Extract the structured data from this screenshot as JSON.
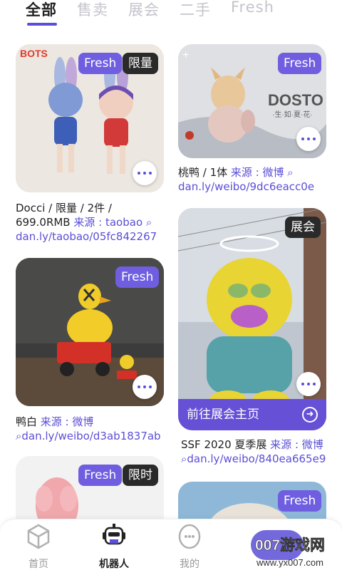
{
  "tabs": [
    "全部",
    "售卖",
    "展会",
    "二手",
    "Fresh"
  ],
  "cards": {
    "docci": {
      "badges": [
        "Fresh",
        "限量"
      ],
      "text": "Docci / 限量 /  2件 / 699.0RMB",
      "source": "来源 : taobao",
      "link": "dan.ly/taobao/05fc842267",
      "logo": "BOTS"
    },
    "taoya": {
      "badges": [
        "Fresh"
      ],
      "text": "桃鸭 / 1体",
      "source": "来源 : 微博",
      "link": "dan.ly/weibo/9dc6eacc0e",
      "image_text": "DOSTO",
      "image_subtext": "·生·如·夏·花·"
    },
    "yabai": {
      "badges": [
        "Fresh"
      ],
      "text": "鸭白",
      "source": "来源 : 微博",
      "link": "dan.ly/weibo/d3ab1837ab"
    },
    "ssf": {
      "badges": [
        "展会"
      ],
      "cta": "前往展会主页",
      "text": "SSF 2020 夏季展",
      "source": "来源 : 微博",
      "link": "dan.ly/weibo/840ea665e9"
    },
    "pink": {
      "badges": [
        "Fresh",
        "限时"
      ]
    },
    "last": {
      "badges": [
        "Fresh"
      ]
    }
  },
  "nav": [
    "首页",
    "机器人",
    "我的"
  ],
  "watermark": {
    "line1": "007游戏网",
    "line2": "www.yx007.com"
  },
  "colors": {
    "accent": "#5a4fd6",
    "fresh": "#6f5ee0",
    "dark_badge": "#2a2a2a"
  }
}
